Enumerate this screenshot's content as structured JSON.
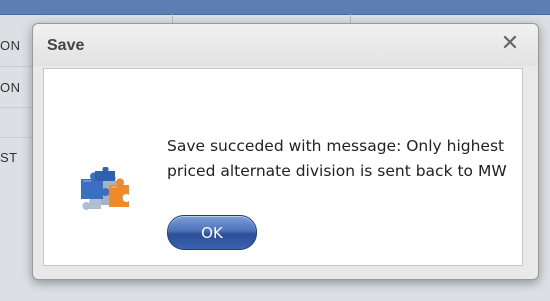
{
  "background": {
    "row_texts": [
      "ON",
      "ON",
      "ST"
    ]
  },
  "dialog": {
    "title": "Save",
    "close_glyph": "✕",
    "icon": "puzzle-pieces-icon",
    "message": "Save succeded with message: Only highest priced alternate division is sent back to MW",
    "ok_label": "OK"
  },
  "colors": {
    "button_blue": "#3d63ad",
    "puzzle_blue": "#3b6fc4",
    "puzzle_orange": "#ee8a2b",
    "puzzle_gray": "#9fb3c9"
  }
}
